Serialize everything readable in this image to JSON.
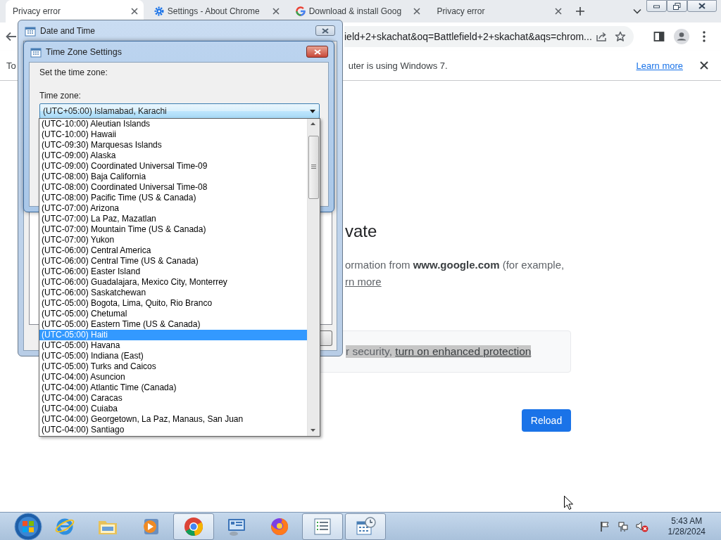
{
  "browser": {
    "tabs": [
      {
        "title": "Privacy error",
        "selected": true
      },
      {
        "title": "Settings - About Chrome",
        "selected": false
      },
      {
        "title": "Download & install Goog",
        "selected": false
      },
      {
        "title": "Privacy error",
        "selected": false
      }
    ],
    "address": "ield+2+skachat&oq=Battlefield+2+skachat&aqs=chrom...",
    "infobar": {
      "text_start": "To",
      "text_end": "uter is using Windows 7.",
      "link": "Learn more"
    }
  },
  "page": {
    "heading": "vate",
    "paragraph": "ormation from **www.google.com** (for example,",
    "learn_more": "rn more",
    "security_text": "r security, ",
    "security_link": "turn on enhanced protection",
    "reload_button": "Reload"
  },
  "date_time_dialog": {
    "title": "Date and Time"
  },
  "time_zone_dialog": {
    "title": "Time Zone Settings",
    "prompt": "Set the time zone:",
    "label": "Time zone:",
    "value": "(UTC+05:00) Islamabad, Karachi",
    "options": [
      {
        "label": "(UTC-10:00) Aleutian Islands",
        "selected": false
      },
      {
        "label": "(UTC-10:00) Hawaii",
        "selected": false
      },
      {
        "label": "(UTC-09:30) Marquesas Islands",
        "selected": false
      },
      {
        "label": "(UTC-09:00) Alaska",
        "selected": false
      },
      {
        "label": "(UTC-09:00) Coordinated Universal Time-09",
        "selected": false
      },
      {
        "label": "(UTC-08:00) Baja California",
        "selected": false
      },
      {
        "label": "(UTC-08:00) Coordinated Universal Time-08",
        "selected": false
      },
      {
        "label": "(UTC-08:00) Pacific Time (US & Canada)",
        "selected": false
      },
      {
        "label": "(UTC-07:00) Arizona",
        "selected": false
      },
      {
        "label": "(UTC-07:00) La Paz, Mazatlan",
        "selected": false
      },
      {
        "label": "(UTC-07:00) Mountain Time (US & Canada)",
        "selected": false
      },
      {
        "label": "(UTC-07:00) Yukon",
        "selected": false
      },
      {
        "label": "(UTC-06:00) Central America",
        "selected": false
      },
      {
        "label": "(UTC-06:00) Central Time (US & Canada)",
        "selected": false
      },
      {
        "label": "(UTC-06:00) Easter Island",
        "selected": false
      },
      {
        "label": "(UTC-06:00) Guadalajara, Mexico City, Monterrey",
        "selected": false
      },
      {
        "label": "(UTC-06:00) Saskatchewan",
        "selected": false
      },
      {
        "label": "(UTC-05:00) Bogota, Lima, Quito, Rio Branco",
        "selected": false
      },
      {
        "label": "(UTC-05:00) Chetumal",
        "selected": false
      },
      {
        "label": "(UTC-05:00) Eastern Time (US & Canada)",
        "selected": false
      },
      {
        "label": "(UTC-05:00) Haiti",
        "selected": true
      },
      {
        "label": "(UTC-05:00) Havana",
        "selected": false
      },
      {
        "label": "(UTC-05:00) Indiana (East)",
        "selected": false
      },
      {
        "label": "(UTC-05:00) Turks and Caicos",
        "selected": false
      },
      {
        "label": "(UTC-04:00) Asuncion",
        "selected": false
      },
      {
        "label": "(UTC-04:00) Atlantic Time (Canada)",
        "selected": false
      },
      {
        "label": "(UTC-04:00) Caracas",
        "selected": false
      },
      {
        "label": "(UTC-04:00) Cuiaba",
        "selected": false
      },
      {
        "label": "(UTC-04:00) Georgetown, La Paz, Manaus, San Juan",
        "selected": false
      },
      {
        "label": "(UTC-04:00) Santiago",
        "selected": false
      }
    ]
  },
  "taskbar": {
    "apps": [
      {
        "kind": "ie",
        "active": false
      },
      {
        "kind": "explorer",
        "active": false
      },
      {
        "kind": "media",
        "active": false
      },
      {
        "kind": "chrome",
        "active": true
      },
      {
        "kind": "remote",
        "active": false
      },
      {
        "kind": "firefox",
        "active": false
      },
      {
        "kind": "list",
        "active": true
      },
      {
        "kind": "calendar",
        "active": true
      }
    ],
    "time": "5:43 AM",
    "date": "1/28/2024"
  }
}
